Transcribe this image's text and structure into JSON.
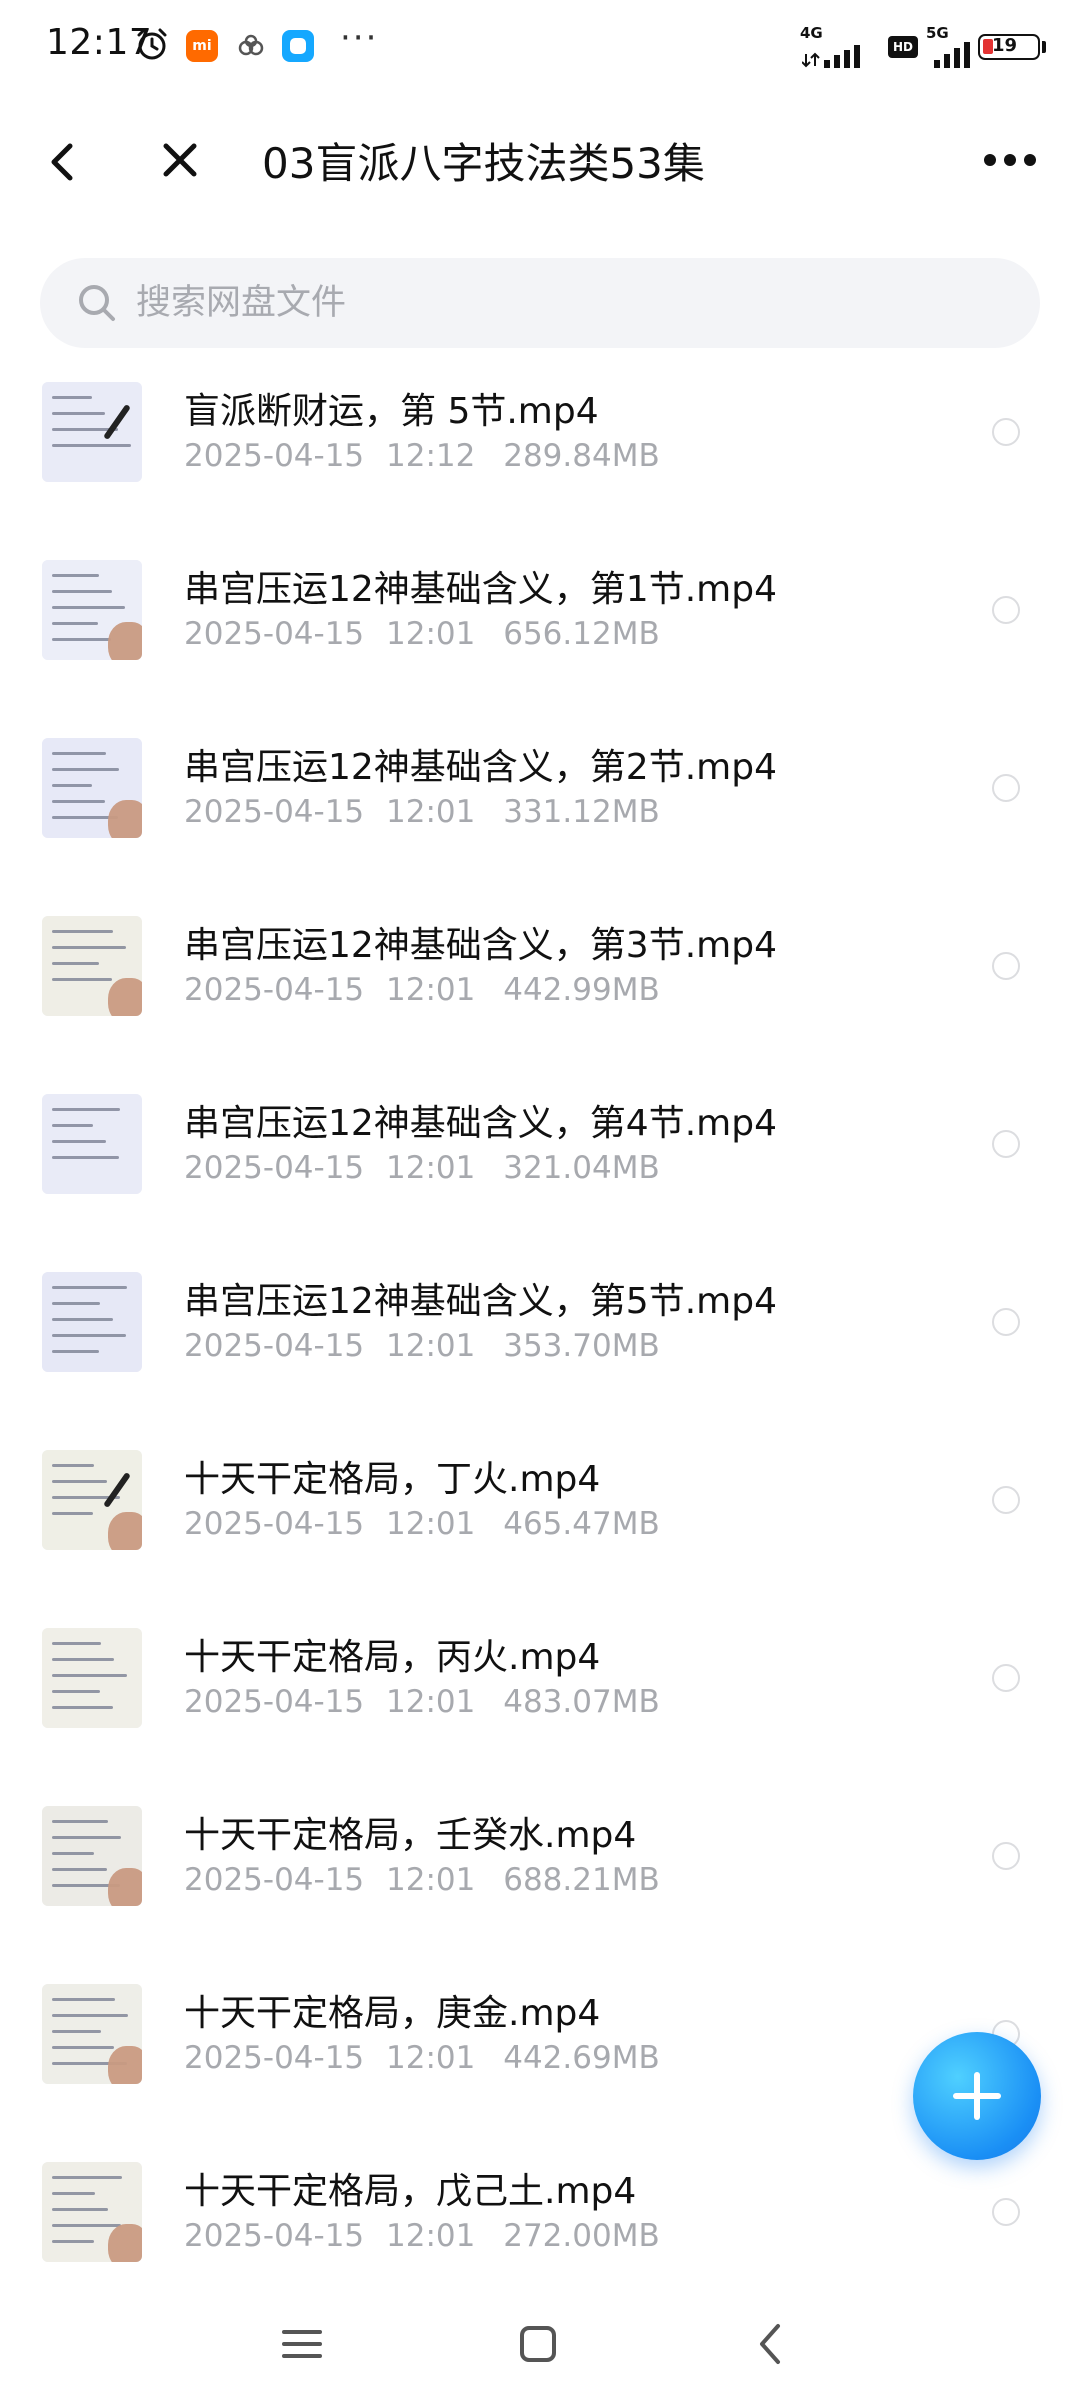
{
  "status_bar": {
    "time": "12:17",
    "network_1": "4G",
    "hd": "HD",
    "network_2": "5G",
    "battery": "19",
    "battery_level_percent": 19,
    "icons": [
      "alarm-icon",
      "mi-app-icon",
      "cloud-app-icon",
      "blue-app-icon",
      "more-dots-icon",
      "signal-icon",
      "battery-icon"
    ],
    "more_dots": "···"
  },
  "header": {
    "title": "03盲派八字技法类53集",
    "back_icon": "chevron-left-icon",
    "close_icon": "close-icon",
    "more_icon": "more-horizontal-icon"
  },
  "search": {
    "placeholder": "搜索网盘文件",
    "value": ""
  },
  "files": [
    {
      "name": "盲派断财运，第 5节.mp4",
      "date": "2025-04-15",
      "time": "12:12",
      "size": "289.84MB"
    },
    {
      "name": "串宫压运12神基础含义，第1节.mp4",
      "date": "2025-04-15",
      "time": "12:01",
      "size": "656.12MB"
    },
    {
      "name": "串宫压运12神基础含义，第2节.mp4",
      "date": "2025-04-15",
      "time": "12:01",
      "size": "331.12MB"
    },
    {
      "name": "串宫压运12神基础含义，第3节.mp4",
      "date": "2025-04-15",
      "time": "12:01",
      "size": "442.99MB"
    },
    {
      "name": "串宫压运12神基础含义，第4节.mp4",
      "date": "2025-04-15",
      "time": "12:01",
      "size": "321.04MB"
    },
    {
      "name": "串宫压运12神基础含义，第5节.mp4",
      "date": "2025-04-15",
      "time": "12:01",
      "size": "353.70MB"
    },
    {
      "name": "十天干定格局，丁火.mp4",
      "date": "2025-04-15",
      "time": "12:01",
      "size": "465.47MB"
    },
    {
      "name": "十天干定格局，丙火.mp4",
      "date": "2025-04-15",
      "time": "12:01",
      "size": "483.07MB"
    },
    {
      "name": "十天干定格局，壬癸水.mp4",
      "date": "2025-04-15",
      "time": "12:01",
      "size": "688.21MB"
    },
    {
      "name": "十天干定格局，庚金.mp4",
      "date": "2025-04-15",
      "time": "12:01",
      "size": "442.69MB"
    },
    {
      "name": "十天干定格局，戊己土.mp4",
      "date": "2025-04-15",
      "time": "12:01",
      "size": "272.00MB"
    }
  ],
  "fab": {
    "icon": "plus-icon"
  },
  "nav": {
    "menu_icon": "menu-icon",
    "home_icon": "home-square-icon",
    "back_icon": "back-chevron-icon"
  },
  "colors": {
    "accent": "#1a8ff5",
    "meta_text": "#a7a9ae",
    "search_bg": "#f3f4f7",
    "battery_low": "#e33333"
  }
}
